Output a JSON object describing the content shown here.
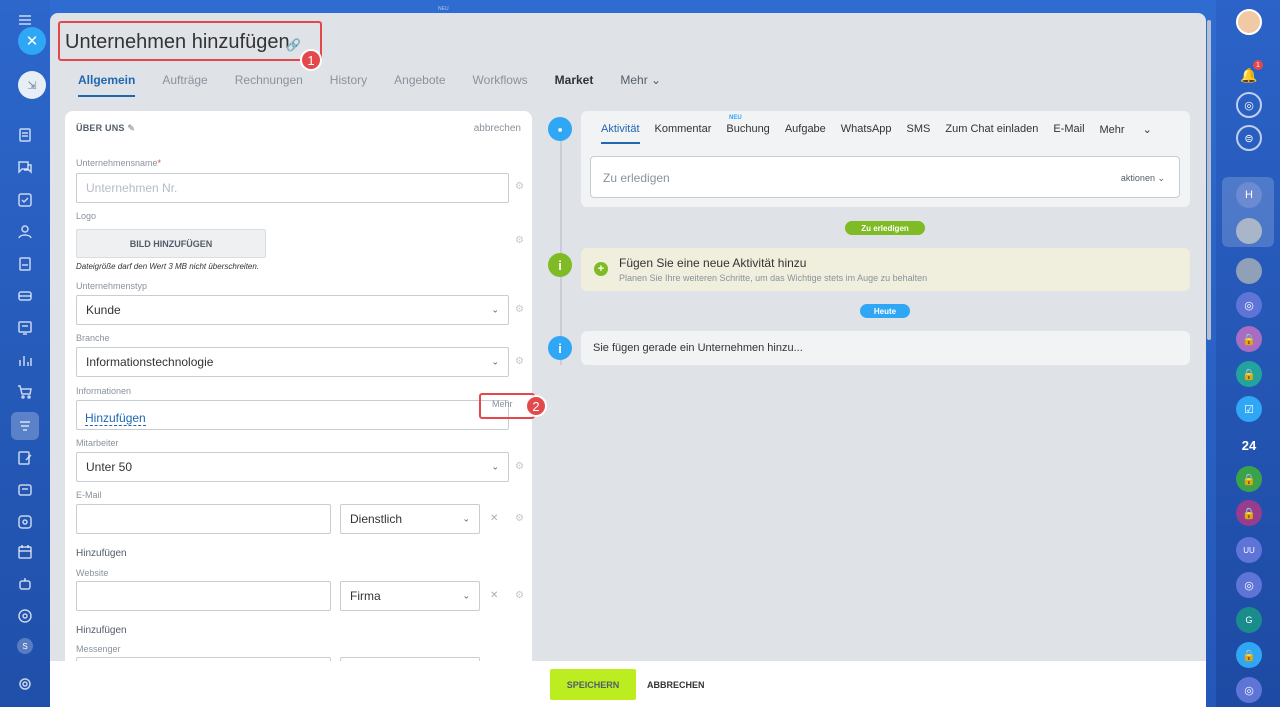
{
  "title": "Unternehmen hinzufügen",
  "callouts": {
    "one": "1",
    "two": "2"
  },
  "top_badge": "NEU",
  "tabs": [
    "Allgemein",
    "Aufträge",
    "Rechnungen",
    "History",
    "Angebote",
    "Workflows",
    "Market",
    "Mehr"
  ],
  "form": {
    "header": "ÜBER UNS",
    "cancel": "abbrechen",
    "company_name_label": "Unternehmensname",
    "company_name_placeholder": "Unternehmen Nr.",
    "logo_label": "Logo",
    "upload_button": "BILD HINZUFÜGEN",
    "upload_hint": "Dateigröße darf den Wert 3 MB nicht überschreiten.",
    "type_label": "Unternehmenstyp",
    "type_value": "Kunde",
    "industry_label": "Branche",
    "industry_value": "Informationstechnologie",
    "info_label": "Informationen",
    "info_more": "Mehr",
    "info_link": "Hinzufügen",
    "employees_label": "Mitarbeiter",
    "employees_value": "Unter 50",
    "email_label": "E-Mail",
    "email_type": "Dienstlich",
    "email_add": "Hinzufügen",
    "website_label": "Website",
    "website_type": "Firma",
    "website_add": "Hinzufügen",
    "messenger_label": "Messenger"
  },
  "activity": {
    "tabs": [
      "Aktivität",
      "Kommentar",
      "Buchung",
      "Aufgabe",
      "WhatsApp",
      "SMS",
      "Zum Chat einladen",
      "E-Mail",
      "Mehr"
    ],
    "new_badge": "NEU",
    "todo_placeholder": "Zu erledigen",
    "todo_actions": "aktionen",
    "todo_pill": "Zu erledigen",
    "notice_title": "Fügen Sie eine neue Aktivität hinzu",
    "notice_sub": "Planen Sie Ihre weiteren Schritte, um das Wichtige stets im Auge zu behalten",
    "today_pill": "Heute",
    "info_text": "Sie fügen gerade ein Unternehmen hinzu..."
  },
  "footer": {
    "save": "SPEICHERN",
    "cancel": "ABBRECHEN"
  },
  "right_bar": {
    "notif_count": "1",
    "h": "H",
    "n24": "24",
    "uu": "UU",
    "g": "G"
  },
  "left_bar": {
    "s": "S"
  },
  "colors": {
    "accent": "#2067b0",
    "save": "#bbed21",
    "callout": "#e3494b",
    "todo_pill": "#7fbb24",
    "today_pill": "#2fa7f5"
  }
}
